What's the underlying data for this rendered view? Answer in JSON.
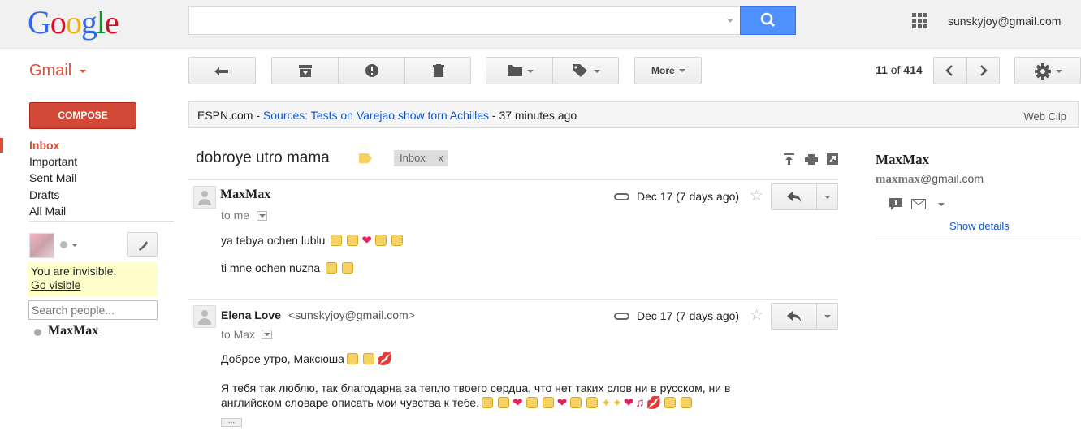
{
  "header": {
    "logo": [
      "G",
      "o",
      "o",
      "g",
      "l",
      "e"
    ],
    "search_value": "",
    "user_email": "sunskyjoy@gmail.com"
  },
  "app": {
    "label": "Gmail"
  },
  "toolbar": {
    "more_label": "More",
    "pager_current": "11",
    "pager_of": "of",
    "pager_total": "414"
  },
  "sidebar": {
    "compose_label": "COMPOSE",
    "nav": [
      "Inbox",
      "Important",
      "Sent Mail",
      "Drafts",
      "All Mail"
    ],
    "invisible_text": "You are invisible.",
    "go_visible_label": "Go visible",
    "search_people_placeholder": "Search people...",
    "contact_name": "MaxMax"
  },
  "webclip": {
    "source": "ESPN.com",
    "dash1": " - ",
    "headline": "Sources: Tests on Varejao show torn Achilles",
    "dash2": " - ",
    "time": "37 minutes ago",
    "label": "Web Clip"
  },
  "thread": {
    "subject": "dobroye utro mama",
    "label_chip": "Inbox",
    "label_chip_close": "x"
  },
  "messages": [
    {
      "sender": "MaxMax",
      "email": "",
      "to": "to me",
      "date": "Dec 17 (7 days ago)",
      "line1": "ya tebya ochen lublu",
      "line2": "ti mne ochen nuzna"
    },
    {
      "sender": "Elena Love",
      "email": "<sunskyjoy@gmail.com>",
      "to": "to Max",
      "date": "Dec 17 (7 days ago)",
      "line1": "Доброе утро, Максюша",
      "line2a": " Я тебя так люблю, так благодарна за тепло твоего сердца, что нет таких слов ни в русском, ни в",
      "line2b": "английском словаре описать мои чувства к тебе."
    }
  ],
  "right_panel": {
    "name": "MaxMax",
    "email_handle": "maxmax",
    "email_domain": "@gmail.com",
    "show_details": "Show details"
  },
  "colors": {
    "accent_red": "#dd4b39",
    "search_blue": "#4d90fe",
    "link_blue": "#1155cc"
  }
}
